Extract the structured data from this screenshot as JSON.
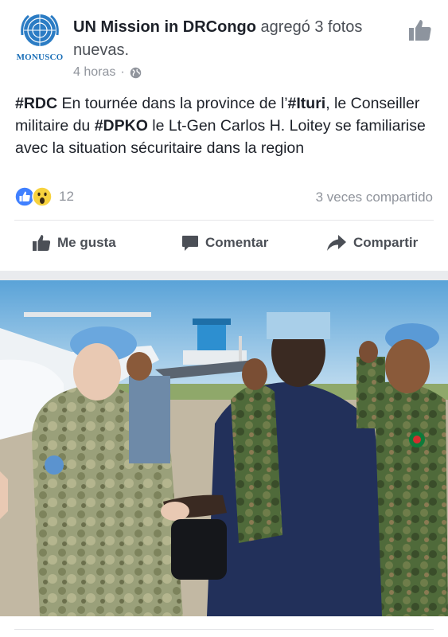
{
  "post": {
    "page_name": "UN Mission in DRCongo",
    "action_text": "agregó 3 fotos nuevas.",
    "avatar_brand": "MONUSCO",
    "timestamp": "4 horas",
    "separator": "·",
    "privacy_icon": "globe-icon",
    "text": {
      "tag1": "#RDC",
      "part1": " En tournée dans la province de l’",
      "tag2": "#Ituri",
      "part2": ", le Conseiller militaire du ",
      "tag3": "#DPKO",
      "part3": " le Lt-Gen Carlos H. Loitey se familiarise avec la situation sécuritaire dans la region"
    },
    "reaction_count": "12",
    "shares": "3 veces compartido"
  },
  "actions": {
    "like": "Me gusta",
    "comment": "Comentar",
    "share": "Compartir"
  },
  "colors": {
    "brand_blue": "#1a6fb8",
    "like_blue": "#4080ff",
    "text_gray": "#90949c"
  }
}
